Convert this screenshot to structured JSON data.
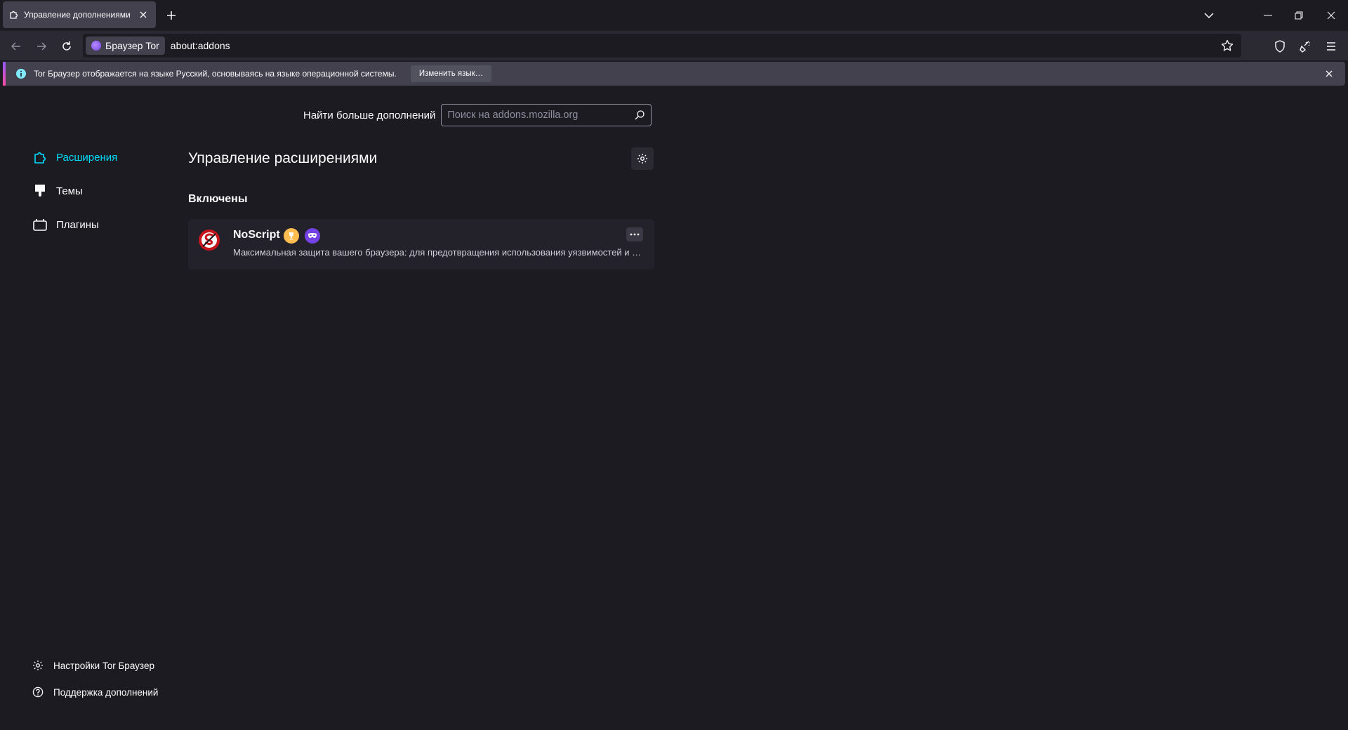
{
  "window": {
    "tab_title": "Управление дополнениями",
    "controls": [
      "minimize",
      "restore",
      "close"
    ]
  },
  "navbar": {
    "identity_label": "Браузер Tor",
    "url": "about:addons"
  },
  "notification": {
    "text": "Tor Браузер отображается на языке Русский, основываясь на языке операционной системы.",
    "button_label": "Изменить язык…"
  },
  "sidebar": {
    "categories": [
      {
        "label": "Расширения",
        "icon": "puzzle-icon",
        "selected": true
      },
      {
        "label": "Темы",
        "icon": "brush-icon",
        "selected": false
      },
      {
        "label": "Плагины",
        "icon": "plugin-icon",
        "selected": false
      }
    ],
    "footer": [
      {
        "label": "Настройки Tor Браузер",
        "icon": "gear-icon"
      },
      {
        "label": "Поддержка дополнений",
        "icon": "help-icon"
      }
    ]
  },
  "main": {
    "search_label": "Найти больше дополнений",
    "search_placeholder": "Поиск на addons.mozilla.org",
    "heading": "Управление расширениями",
    "section_enabled": "Включены",
    "addons": [
      {
        "name": "NoScript",
        "description": "Максимальная защита вашего браузера: для предотвращения использования уязвимостей и межсайтовых атак",
        "badges": [
          "recommended-badge",
          "private-browsing-badge"
        ]
      }
    ]
  },
  "colors": {
    "background": "#1c1b22",
    "toolbar": "#2b2a33",
    "accent": "#00ddff",
    "tor_purple": "#7542e5"
  }
}
